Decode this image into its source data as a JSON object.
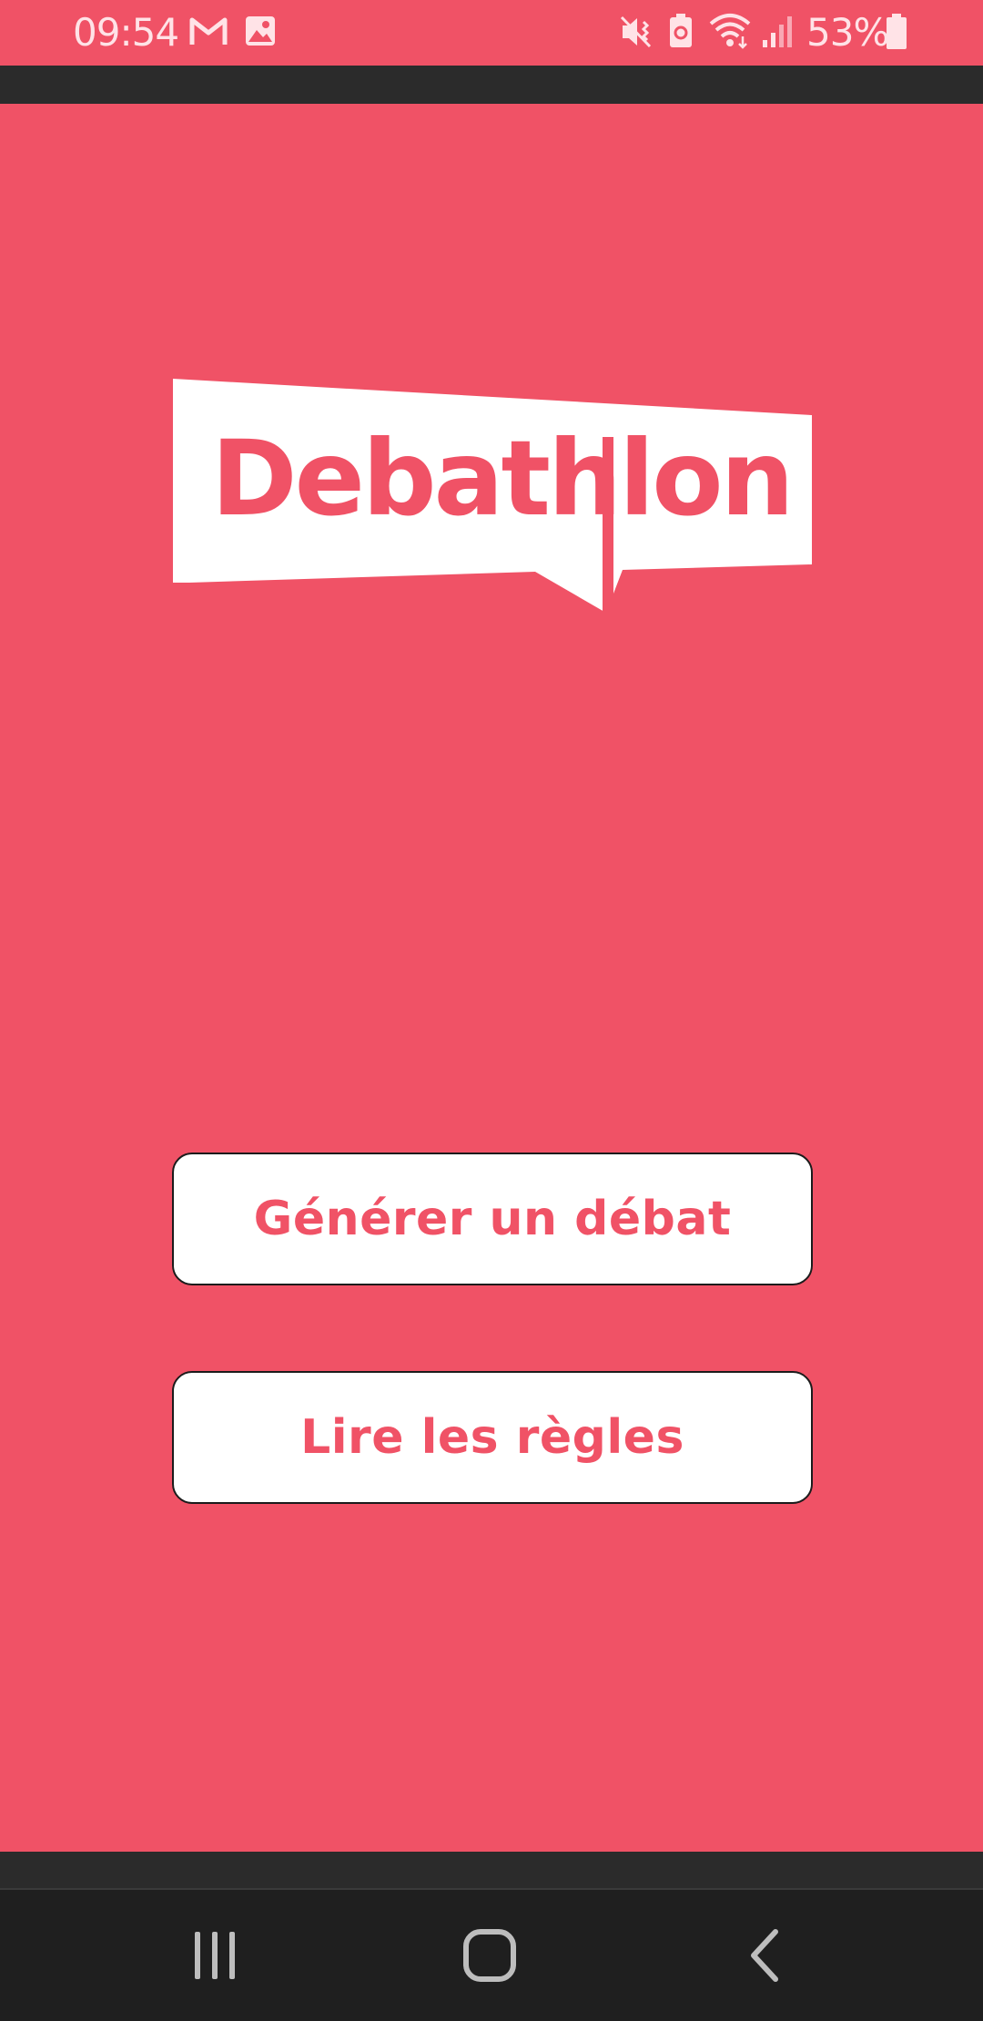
{
  "status_bar": {
    "time": "09:54",
    "battery_percent": "53%",
    "notification_icons": [
      "gmail-icon",
      "gallery-icon"
    ],
    "system_icons": [
      "vibrate-icon",
      "battery-saver-icon",
      "wifi-icon",
      "signal-icon",
      "battery-icon"
    ]
  },
  "logo": {
    "text": "Debathlon"
  },
  "actions": {
    "generate_label": "Générer un débat",
    "rules_label": "Lire les règles"
  },
  "nav": {
    "items": [
      "recent-apps",
      "home",
      "back"
    ]
  },
  "colors": {
    "background": "#f05266",
    "button_bg": "#ffffff",
    "button_text": "#f05266",
    "bar_dark": "#1f1f1f"
  }
}
